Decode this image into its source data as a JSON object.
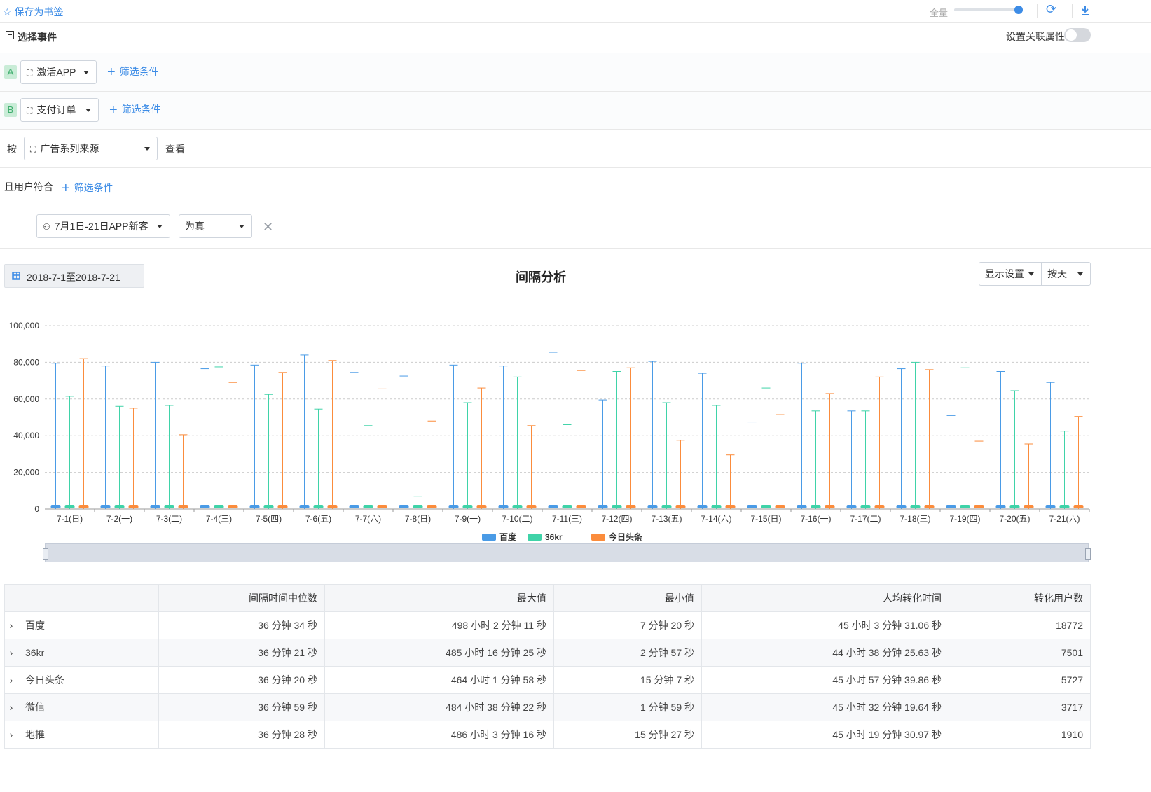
{
  "topbar": {
    "bookmark_label": "保存为书签",
    "slider_label": "全量"
  },
  "event_section": {
    "title": "选择事件",
    "toggle_label": "设置关联属性"
  },
  "steps": [
    {
      "tag": "A",
      "event": "激活APP",
      "filter_label": "筛选条件"
    },
    {
      "tag": "B",
      "event": "支付订单",
      "filter_label": "筛选条件"
    }
  ],
  "groupby": {
    "prefix": "按",
    "value": "广告系列来源",
    "suffix": "查看"
  },
  "user_filter": {
    "label": "且用户符合",
    "add_label": "筛选条件",
    "segment": "7月1日-21日APP新客",
    "condition": "为真"
  },
  "toolbar": {
    "date_range": "2018-7-1至2018-7-21",
    "title": "间隔分析",
    "display_settings": "显示设置",
    "granularity": "按天"
  },
  "chart_data": {
    "type": "boxplot",
    "categories": [
      "7-1(日)",
      "7-2(一)",
      "7-3(二)",
      "7-4(三)",
      "7-5(四)",
      "7-6(五)",
      "7-7(六)",
      "7-8(日)",
      "7-9(一)",
      "7-10(二)",
      "7-11(三)",
      "7-12(四)",
      "7-13(五)",
      "7-14(六)",
      "7-15(日)",
      "7-16(一)",
      "7-17(二)",
      "7-18(三)",
      "7-19(四)",
      "7-20(五)",
      "7-21(六)"
    ],
    "y_ticks": [
      "0",
      "20,000",
      "40,000",
      "60,000",
      "80,000",
      "100,000"
    ],
    "ylim": [
      0,
      100000
    ],
    "legend": [
      "百度",
      "36kr",
      "今日头条"
    ],
    "series": [
      {
        "name": "百度",
        "color": "#4a9be6",
        "max": [
          79500,
          78000,
          80000,
          76500,
          78500,
          84000,
          74500,
          72500,
          78500,
          78000,
          85500,
          59500,
          80500,
          74000,
          47500,
          79500,
          53500,
          76500,
          51000,
          75000,
          69000
        ]
      },
      {
        "name": "36kr",
        "color": "#3fd3a8",
        "max": [
          61500,
          56000,
          56500,
          77500,
          62500,
          54500,
          45500,
          7000,
          58000,
          72000,
          46000,
          75000,
          58000,
          56500,
          66000,
          53500,
          53500,
          80000,
          77000,
          64500,
          42500
        ]
      },
      {
        "name": "今日头条",
        "color": "#fb8c3c",
        "max": [
          82000,
          55000,
          40500,
          69000,
          74500,
          81000,
          65500,
          48000,
          66000,
          45500,
          75500,
          77000,
          37500,
          29500,
          51500,
          63000,
          72000,
          76000,
          37000,
          35500,
          50500
        ]
      }
    ]
  },
  "table": {
    "headers": [
      "",
      "间隔时间中位数",
      "最大值",
      "最小值",
      "人均转化时间",
      "转化用户数"
    ],
    "rows": [
      [
        "百度",
        "36 分钟 34 秒",
        "498 小时 2 分钟 11 秒",
        "7 分钟 20 秒",
        "45 小时 3 分钟 31.06 秒",
        "18772"
      ],
      [
        "36kr",
        "36 分钟 21 秒",
        "485 小时 16 分钟 25 秒",
        "2 分钟 57 秒",
        "44 小时 38 分钟 25.63 秒",
        "7501"
      ],
      [
        "今日头条",
        "36 分钟 20 秒",
        "464 小时 1 分钟 58 秒",
        "15 分钟 7 秒",
        "45 小时 57 分钟 39.86 秒",
        "5727"
      ],
      [
        "微信",
        "36 分钟 59 秒",
        "484 小时 38 分钟 22 秒",
        "1 分钟 59 秒",
        "45 小时 32 分钟 19.64 秒",
        "3717"
      ],
      [
        "地推",
        "36 分钟 28 秒",
        "486 小时 3 分钟 16 秒",
        "15 分钟 27 秒",
        "45 小时 19 分钟 30.97 秒",
        "1910"
      ]
    ]
  }
}
